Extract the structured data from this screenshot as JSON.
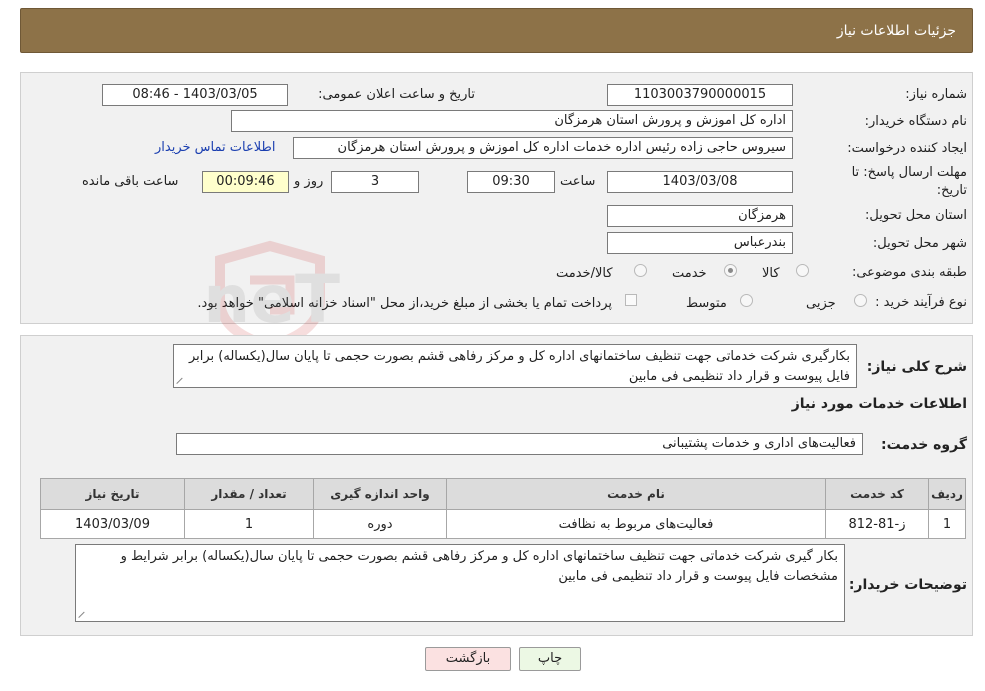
{
  "header": {
    "title": "جزئیات اطلاعات نیاز"
  },
  "form": {
    "need_number_label": "شماره نیاز:",
    "need_number": "1103003790000015",
    "announce_label": "تاریخ و ساعت اعلان عمومی:",
    "announce_value": "1403/03/05 - 08:46",
    "buyer_org_label": "نام دستگاه خریدار:",
    "buyer_org": "اداره کل اموزش و پرورش استان هرمزگان",
    "creator_label": "ایجاد کننده درخواست:",
    "creator": "سیروس  حاجی زاده رئیس اداره خدمات اداره کل اموزش و پرورش استان هرمزگان",
    "contact_link": "اطلاعات تماس خریدار",
    "deadline_label_1": "مهلت ارسال پاسخ: تا",
    "deadline_label_2": "تاریخ:",
    "deadline_date": "1403/03/08",
    "time_label": "ساعت",
    "deadline_time": "09:30",
    "days_value": "3",
    "days_label": "روز و",
    "remaining_time": "00:09:46",
    "remaining_label": "ساعت باقی مانده",
    "province_label": "استان محل تحویل:",
    "province": "هرمزگان",
    "city_label": "شهر محل تحویل:",
    "city": "بندرعباس",
    "category_label": "طبقه بندی موضوعی:",
    "category_options": [
      "کالا",
      "خدمت",
      "کالا/خدمت"
    ],
    "category_selected": "خدمت",
    "purchase_type_label": "نوع فرآیند خرید :",
    "purchase_options": [
      "جزیی",
      "متوسط"
    ],
    "payment_note": "پرداخت تمام یا بخشی از مبلغ خرید،از محل \"اسناد خزانه اسلامی\" خواهد بود."
  },
  "details": {
    "description_label": "شرح کلی نیاز:",
    "description": "بکارگیری شرکت خدماتی جهت تنظیف ساختمانهای اداره کل و مرکز رفاهی قشم بصورت حجمی تا پایان سال(یکساله) برابر  فایل پیوست و قرار داد تنظیمی فی مابین",
    "services_heading": "اطلاعات خدمات مورد نیاز",
    "service_group_label": "گروه خدمت:",
    "service_group": "فعالیت‌های اداری و خدمات پشتیبانی",
    "table": {
      "headers": [
        "ردیف",
        "کد خدمت",
        "نام خدمت",
        "واحد اندازه گیری",
        "تعداد / مقدار",
        "تاریخ نیاز"
      ],
      "rows": [
        [
          "1",
          "ز-81-812",
          "فعالیت‌های مربوط به نظافت",
          "دوره",
          "1",
          "1403/03/09"
        ]
      ]
    },
    "buyer_notes_label": "توضیحات خریدار:",
    "buyer_notes": "بکار گیری شرکت خدماتی جهت تنظیف ساختمانهای اداره کل و مرکز رفاهی قشم بصورت حجمی تا پایان سال(یکساله) برابر شرایط و مشخصات فایل پیوست و قرار داد تنظیمی فی مابین"
  },
  "buttons": {
    "print": "چاپ",
    "back": "بازگشت"
  },
  "watermark": {
    "text": "AriaTender.neT"
  },
  "colors": {
    "header_bg": "#8d7248",
    "link": "#1b3fb0",
    "remaining_bg": "#ffffcc"
  }
}
